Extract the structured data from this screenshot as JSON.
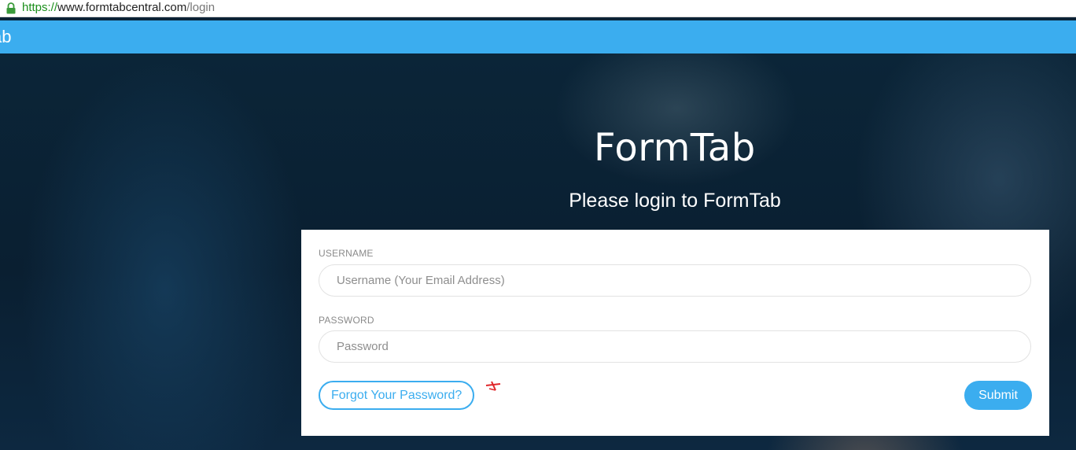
{
  "browser": {
    "url_scheme": "https://",
    "url_host": "www.formtabcentral.com",
    "url_path": "/login"
  },
  "header": {
    "brand": "ab"
  },
  "hero": {
    "logo": "FormTab",
    "subtitle": "Please login to FormTab"
  },
  "login": {
    "username_label": "USERNAME",
    "username_placeholder": "Username (Your Email Address)",
    "username_value": "",
    "password_label": "PASSWORD",
    "password_placeholder": "Password",
    "password_value": "",
    "forgot_label": "Forgot Your Password?",
    "submit_label": "Submit"
  },
  "colors": {
    "accent": "#3badef",
    "annotation": "#e0262a"
  }
}
